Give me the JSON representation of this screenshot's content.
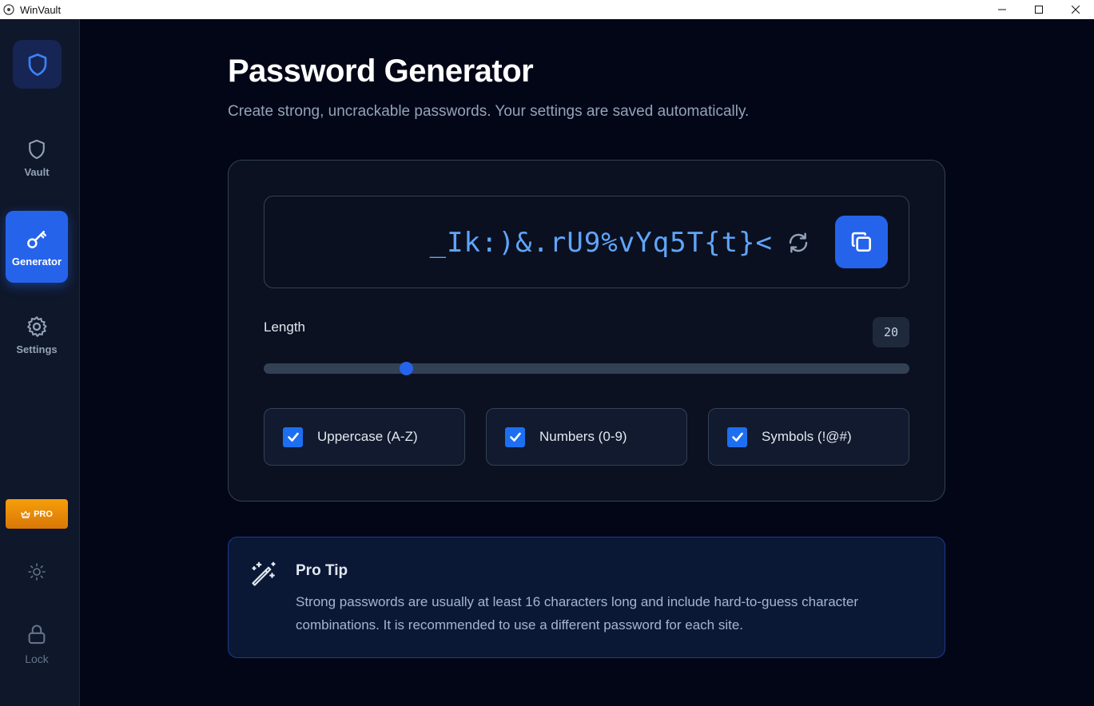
{
  "window": {
    "title": "WinVault",
    "icons": [
      "app-icon",
      "minimize-icon",
      "maximize-icon",
      "close-icon"
    ]
  },
  "sidebar": {
    "logo_icon": "shield-icon",
    "items": [
      {
        "label": "Vault",
        "icon": "shield-icon",
        "active": false
      },
      {
        "label": "Generator",
        "icon": "key-icon",
        "active": true
      },
      {
        "label": "Settings",
        "icon": "gear-icon",
        "active": false
      }
    ],
    "pro_label": "PRO",
    "pro_icon": "crown-icon",
    "theme_icon": "sun-icon",
    "lock_label": "Lock",
    "lock_icon": "lock-icon"
  },
  "page": {
    "title": "Password Generator",
    "subtitle": "Create strong, uncrackable passwords. Your settings are saved automatically."
  },
  "generator": {
    "password": "_Ik:)&.rU9%vYq5T{t}<",
    "refresh_icon": "refresh-icon",
    "copy_icon": "copy-icon",
    "length_label": "Length",
    "length_value": "20",
    "slider_fraction": 0.22,
    "options": [
      {
        "label": "Uppercase (A-Z)",
        "checked": true
      },
      {
        "label": "Numbers (0-9)",
        "checked": true
      },
      {
        "label": "Symbols (!@#)",
        "checked": true
      }
    ]
  },
  "tip": {
    "icon": "magic-wand-icon",
    "title": "Pro Tip",
    "body": "Strong passwords are usually at least 16 characters long and include hard-to-guess character combinations. It is recommended to use a different password for each site."
  },
  "colors": {
    "accent": "#2563eb",
    "password_text": "#60a5fa",
    "pro": "#f59e0b"
  }
}
